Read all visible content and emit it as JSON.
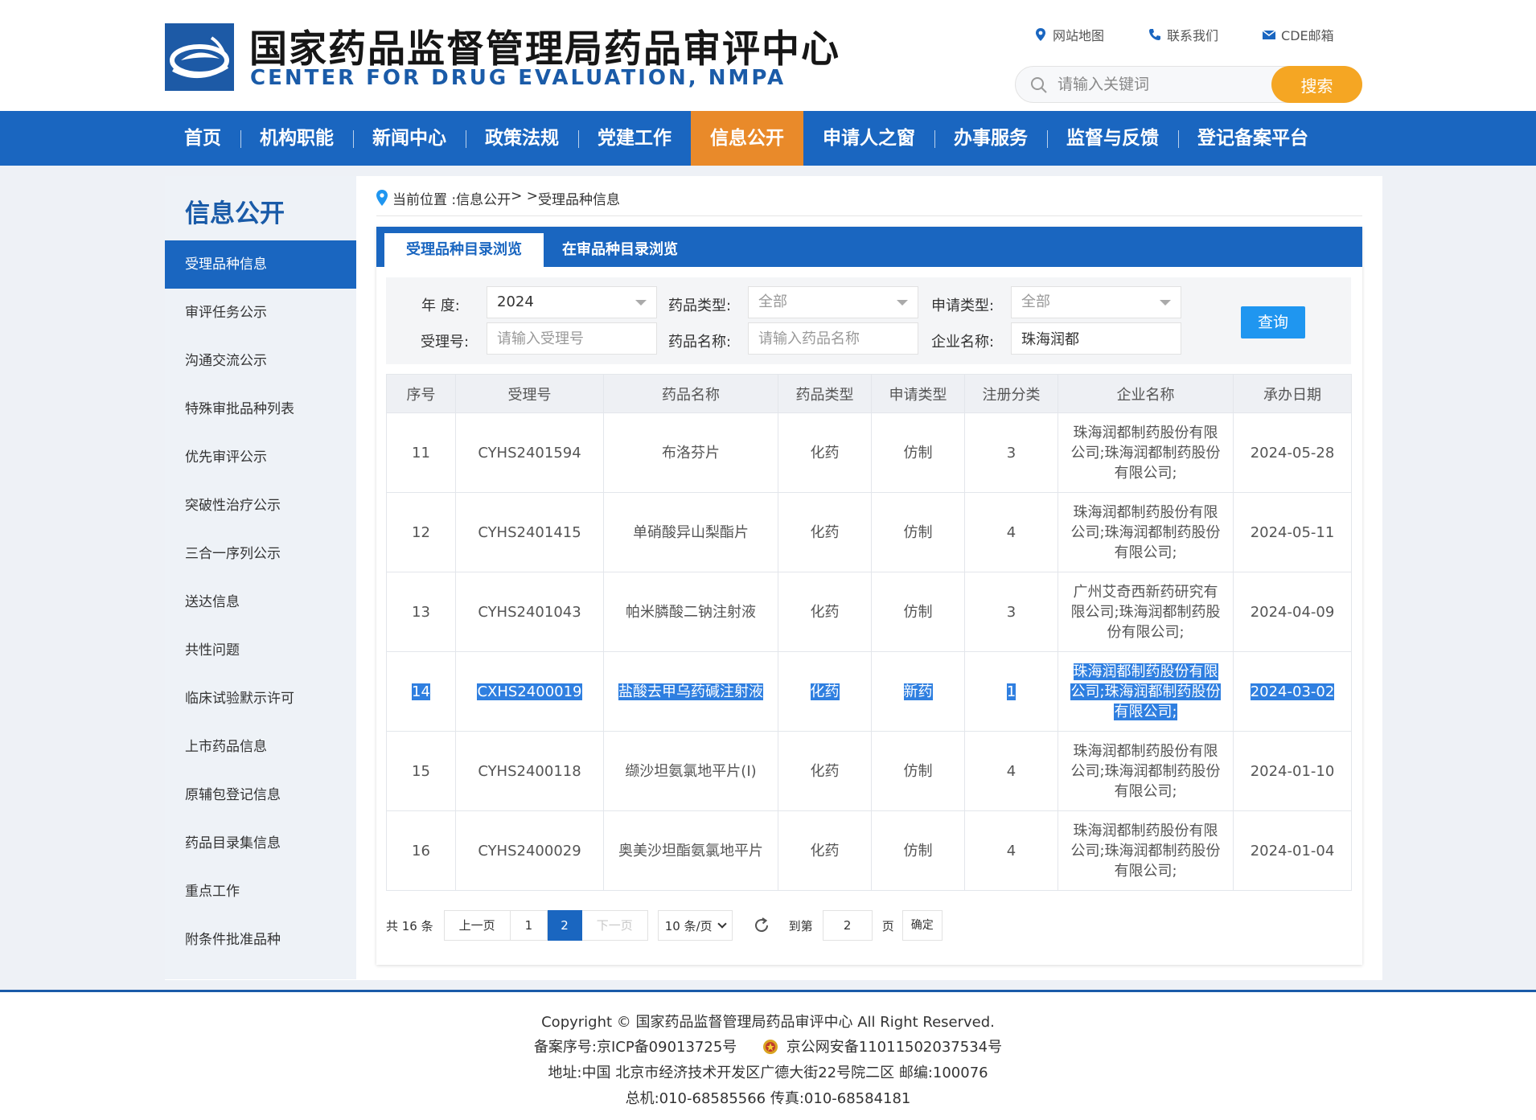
{
  "header": {
    "title_cn": "国家药品监督管理局药品审评中心",
    "title_en": "CENTER FOR DRUG EVALUATION, NMPA",
    "links": [
      {
        "label": "网站地图",
        "icon": "map-pin-icon"
      },
      {
        "label": "联系我们",
        "icon": "phone-icon"
      },
      {
        "label": "CDE邮箱",
        "icon": "mail-icon"
      }
    ],
    "search_placeholder": "请输入关键词",
    "search_button": "搜索",
    "brand_color": "#1a66c0",
    "accent_color": "#e98a2a"
  },
  "nav": {
    "items": [
      "首页",
      "机构职能",
      "新闻中心",
      "政策法规",
      "党建工作",
      "信息公开",
      "申请人之窗",
      "办事服务",
      "监督与反馈",
      "登记备案平台"
    ],
    "active": "信息公开"
  },
  "sidebar": {
    "title": "信息公开",
    "items": [
      "受理品种信息",
      "审评任务公示",
      "沟通交流公示",
      "特殊审批品种列表",
      "优先审评公示",
      "突破性治疗公示",
      "三合一序列公示",
      "送达信息",
      "共性问题",
      "临床试验默示许可",
      "上市药品信息",
      "原辅包登记信息",
      "药品目录集信息",
      "重点工作",
      "附条件批准品种"
    ],
    "active": "受理品种信息"
  },
  "breadcrumb": {
    "prefix": "当前位置 : ",
    "section": "信息公开",
    "sep": " > > ",
    "current": "受理品种信息"
  },
  "tabs": [
    "受理品种目录浏览",
    "在审品种目录浏览"
  ],
  "filter": {
    "year_label": "年 度:",
    "year_value": "2024",
    "drug_type_label": "药品类型:",
    "drug_type_value": "全部",
    "apply_type_label": "申请类型:",
    "apply_type_value": "全部",
    "accept_no_label": "受理号:",
    "accept_no_placeholder": "请输入受理号",
    "drug_name_label": "药品名称:",
    "drug_name_placeholder": "请输入药品名称",
    "company_label": "企业名称:",
    "company_value": "珠海润都",
    "query_button": "查询"
  },
  "table": {
    "headers": [
      "序号",
      "受理号",
      "药品名称",
      "药品类型",
      "申请类型",
      "注册分类",
      "企业名称",
      "承办日期"
    ],
    "rows": [
      [
        "11",
        "CYHS2401594",
        "布洛芬片",
        "化药",
        "仿制",
        "3",
        "珠海润都制药股份有限公司;珠海润都制药股份有限公司;",
        "2024-05-28"
      ],
      [
        "12",
        "CYHS2401415",
        "单硝酸异山梨酯片",
        "化药",
        "仿制",
        "4",
        "珠海润都制药股份有限公司;珠海润都制药股份有限公司;",
        "2024-05-11"
      ],
      [
        "13",
        "CYHS2401043",
        "帕米膦酸二钠注射液",
        "化药",
        "仿制",
        "3",
        "广州艾奇西新药研究有限公司;珠海润都制药股份有限公司;",
        "2024-04-09"
      ],
      [
        "14",
        "CXHS2400019",
        "盐酸去甲乌药碱注射液",
        "化药",
        "新药",
        "1",
        "珠海润都制药股份有限公司;珠海润都制药股份有限公司;",
        "2024-03-02"
      ],
      [
        "15",
        "CYHS2400118",
        "缬沙坦氨氯地平片(I)",
        "化药",
        "仿制",
        "4",
        "珠海润都制药股份有限公司;珠海润都制药股份有限公司;",
        "2024-01-10"
      ],
      [
        "16",
        "CYHS2400029",
        "奥美沙坦酯氨氯地平片",
        "化药",
        "仿制",
        "4",
        "珠海润都制药股份有限公司;珠海润都制药股份有限公司;",
        "2024-01-04"
      ]
    ],
    "selected_row": 3
  },
  "pager": {
    "total": "共 16 条",
    "prev": "上一页",
    "pages": [
      "1",
      "2"
    ],
    "current": "2",
    "next": "下一页",
    "page_size": "10 条/页",
    "goto_label": "到第",
    "goto_value": "2",
    "page_unit": "页",
    "confirm": "确定"
  },
  "footer": {
    "copyright": "Copyright © 国家药品监督管理局药品审评中心   All Right Reserved.",
    "icp": "备案序号:京ICP备09013725号",
    "police": "京公网安备11011502037534号",
    "address": "地址:中国 北京市经济技术开发区广德大街22号院二区     邮编:100076",
    "phone": "总机:010-68585566     传真:010-68584181"
  }
}
